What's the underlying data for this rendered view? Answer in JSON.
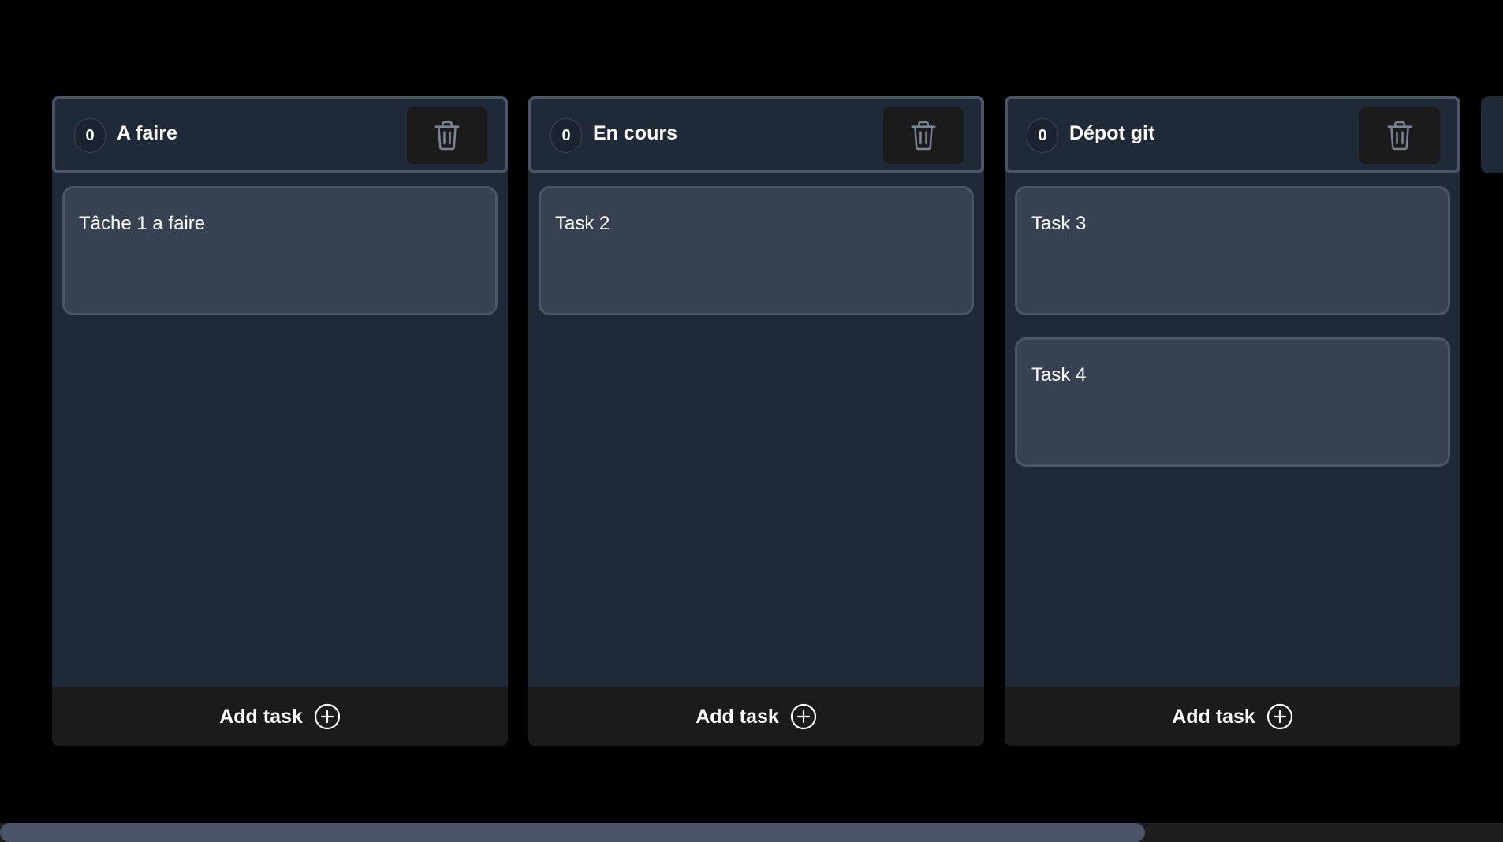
{
  "columns": [
    {
      "count": "0",
      "title": "A faire",
      "tasks": [
        "Tâche 1 a faire"
      ],
      "add_label": "Add task"
    },
    {
      "count": "0",
      "title": "En cours",
      "tasks": [
        "Task 2"
      ],
      "add_label": "Add task"
    },
    {
      "count": "0",
      "title": "Dépot git",
      "tasks": [
        "Task 3",
        "Task 4"
      ],
      "add_label": "Add task"
    }
  ],
  "scrollbar": {
    "visible_fraction": 0.762
  },
  "colors": {
    "background": "#000000",
    "column_bg": "#202938",
    "header_border": "#4b5567",
    "card_bg": "#384152",
    "button_bg": "#1b1b1b",
    "icon_gray": "#7a8494"
  },
  "icons": {
    "delete": "trash-icon",
    "add": "plus-circle-icon"
  }
}
